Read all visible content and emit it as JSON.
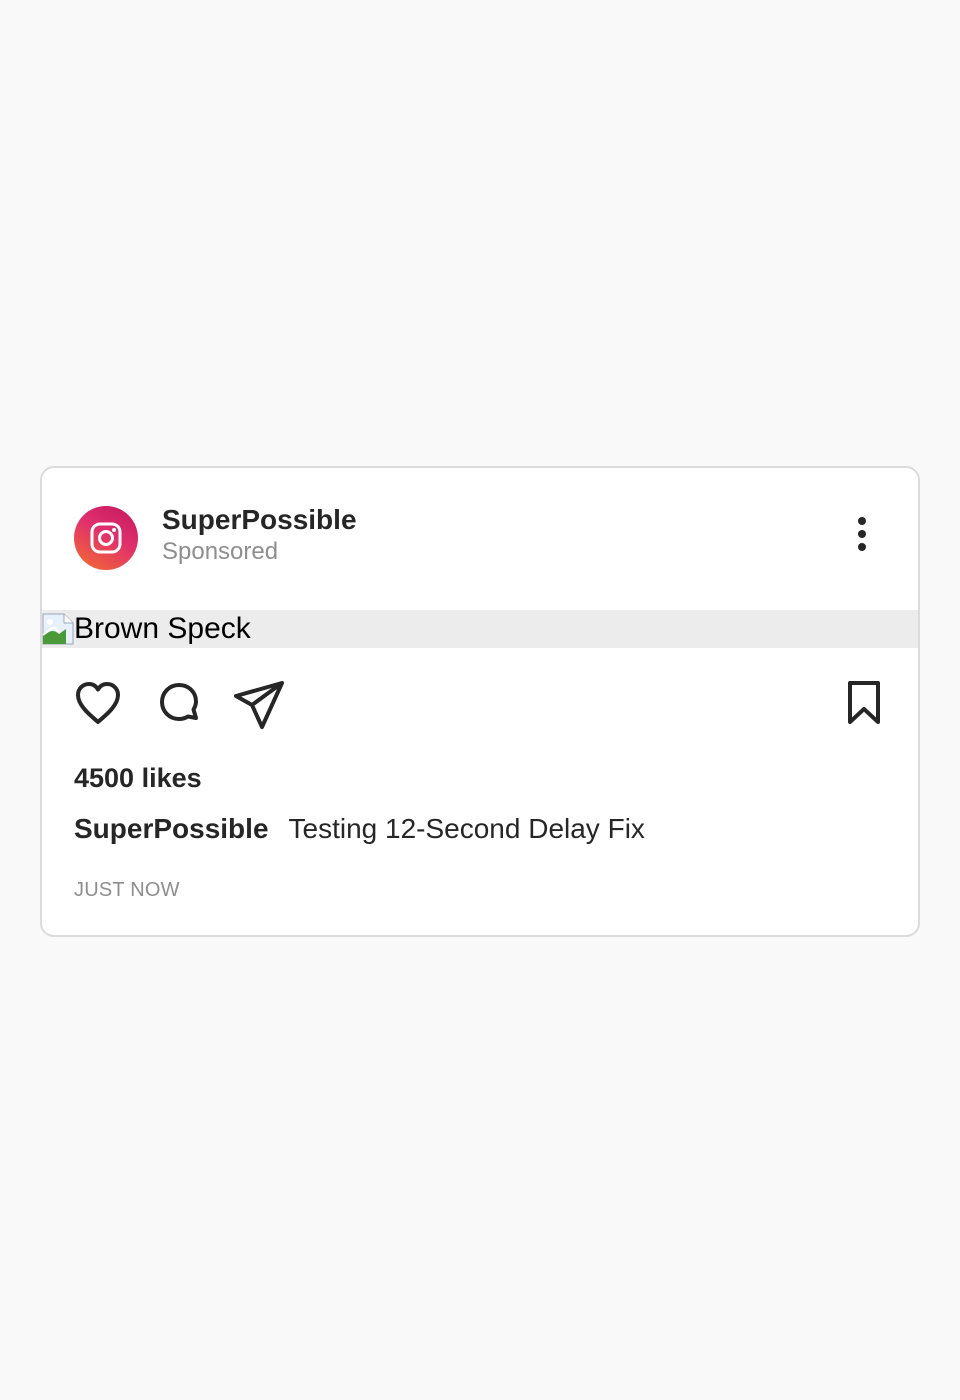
{
  "post": {
    "account_name": "SuperPossible",
    "sponsored_label": "Sponsored",
    "media_alt": "Brown Speck",
    "likes": "4500 likes",
    "caption_user": "SuperPossible",
    "caption_text": "Testing 12-Second Delay Fix",
    "timestamp": "JUST NOW"
  },
  "icons": {
    "avatar": "instagram-logo-icon",
    "more": "more-vertical-icon",
    "media": "broken-image-icon",
    "like": "heart-icon",
    "comment": "comment-icon",
    "share": "paper-plane-icon",
    "save": "bookmark-icon"
  },
  "colors": {
    "background": "#f9f9f9",
    "card": "#ffffff",
    "border": "#dbdbdb",
    "text_primary": "#262626",
    "text_secondary": "#8e8e8e",
    "media_placeholder": "#ececec",
    "avatar_gradient_start": "#f2702d",
    "avatar_gradient_end": "#c1185f"
  }
}
